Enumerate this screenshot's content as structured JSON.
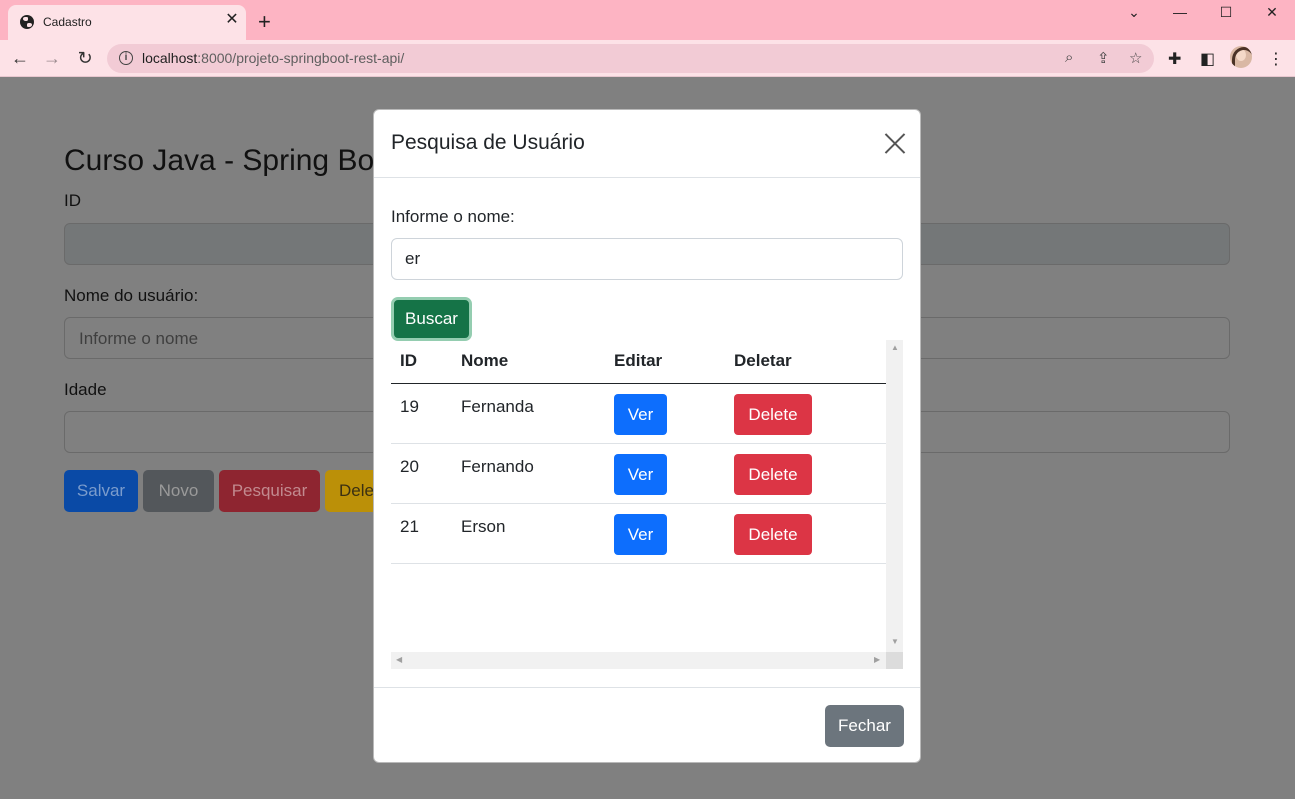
{
  "browser": {
    "tab_title": "Cadastro",
    "url_host": "localhost",
    "url_rest": ":8000/projeto-springboot-rest-api/"
  },
  "page": {
    "title": "Curso Java - Spring Bo",
    "labels": {
      "id": "ID",
      "nome": "Nome do usuário:",
      "idade": "Idade"
    },
    "nome_placeholder": "Informe o nome",
    "buttons": {
      "salvar": "Salvar",
      "novo": "Novo",
      "pesquisar": "Pesquisar",
      "deletar": "Dele"
    }
  },
  "modal": {
    "title": "Pesquisa de Usuário",
    "search_label": "Informe o nome:",
    "search_value": "er",
    "search_button": "Buscar",
    "table": {
      "headers": [
        "ID",
        "Nome",
        "Editar",
        "Deletar"
      ],
      "rows": [
        {
          "id": "19",
          "nome": "Fernanda",
          "ver": "Ver",
          "delete": "Delete"
        },
        {
          "id": "20",
          "nome": "Fernando",
          "ver": "Ver",
          "delete": "Delete"
        },
        {
          "id": "21",
          "nome": "Erson",
          "ver": "Ver",
          "delete": "Delete"
        }
      ]
    },
    "close_button": "Fechar"
  },
  "colors": {
    "tabbar": "#fdb4c3",
    "buscar": "#157347",
    "ver": "#0d6efd",
    "delete": "#dc3545",
    "fechar": "#6c757d"
  }
}
